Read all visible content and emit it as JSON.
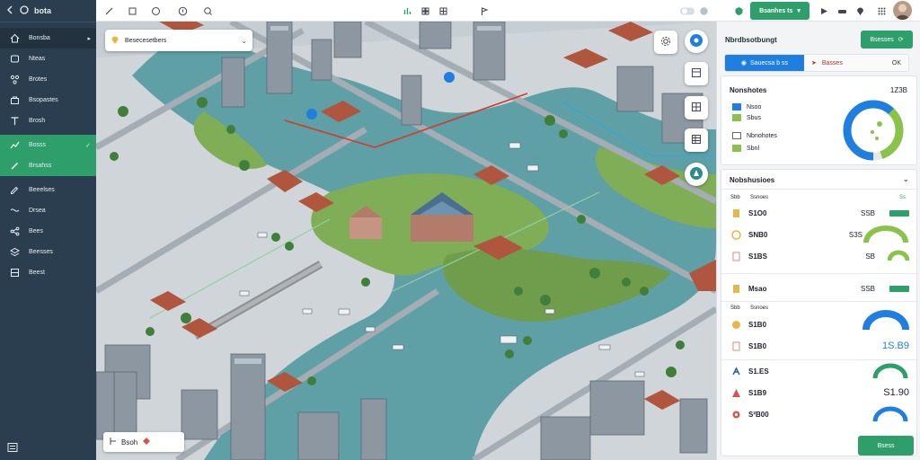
{
  "app": {
    "title": "bota"
  },
  "sidebar": {
    "items": [
      {
        "label": "Bonsba",
        "icon": "home-icon"
      },
      {
        "label": "Nteas",
        "icon": "square-icon"
      },
      {
        "label": "Brotes",
        "icon": "network-icon"
      },
      {
        "label": "Bsopastes",
        "icon": "bag-icon"
      },
      {
        "label": "Brosh",
        "icon": "text-icon"
      },
      {
        "label": "Bosss",
        "icon": "chart-icon"
      },
      {
        "label": "Brsahss",
        "icon": "edit-icon"
      },
      {
        "label": "Beeelses",
        "icon": "pencil-icon"
      },
      {
        "label": "Drsea",
        "icon": "route-icon"
      },
      {
        "label": "Bees",
        "icon": "share-icon"
      },
      {
        "label": "Beesses",
        "icon": "stack-icon"
      },
      {
        "label": "Beest",
        "icon": "table-icon"
      }
    ]
  },
  "topbar": {
    "primary_label": "Bsanhes ts",
    "accent": "#2e9e6a"
  },
  "map": {
    "search_value": "Besecesetbers",
    "legend_label": "Bsoh"
  },
  "panel": {
    "title": "Nbrdbsotbungt",
    "action_label": "Bsesses",
    "tab_active": "Sauecsa b ss",
    "tab_other": "Basses",
    "tab_pct": "OK",
    "summary": {
      "title": "Nonshotes",
      "value": "1Z3B",
      "legend": [
        "Nsoo",
        "Sbus",
        "Nbnohotes",
        "Sbnl"
      ],
      "donut": {
        "blue": 0.62,
        "green": 0.33
      }
    },
    "metrics": {
      "title": "Nobshusioes",
      "subheader_left": "Sbb",
      "subheader_mid": "Ssnoes",
      "subheader_right": "Ss",
      "rows": [
        {
          "label": "S1O0",
          "value": "SSB"
        },
        {
          "label": "SNB0",
          "value": "S3S"
        },
        {
          "label": "S1BS",
          "value": "SB"
        },
        {
          "label": "Msao",
          "value": "SSB"
        },
        {
          "label": "S1B0",
          "value": ""
        },
        {
          "label": "S1B0",
          "value": "1S.B9"
        },
        {
          "label": "S1.ES",
          "value": ""
        },
        {
          "label": "S1B9",
          "value": "S1.90"
        },
        {
          "label": "S²B00",
          "value": ""
        }
      ],
      "group_header": {
        "left": "Sbb",
        "mid": "Ssnoes"
      }
    },
    "footer_label": "Bsess"
  }
}
